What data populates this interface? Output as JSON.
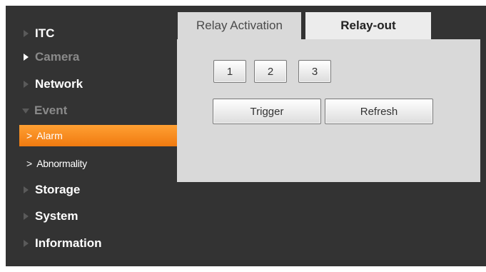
{
  "sidebar": {
    "items": [
      {
        "label": "ITC"
      },
      {
        "label": "Camera"
      },
      {
        "label": "Network"
      },
      {
        "label": "Event"
      },
      {
        "label": "Alarm"
      },
      {
        "label": "Abnormality"
      },
      {
        "label": "Storage"
      },
      {
        "label": "System"
      },
      {
        "label": "Information"
      }
    ]
  },
  "tabs": [
    {
      "label": "Relay Activation"
    },
    {
      "label": "Relay-out"
    }
  ],
  "relay_buttons": [
    {
      "label": "1"
    },
    {
      "label": "2"
    },
    {
      "label": "3"
    }
  ],
  "actions": {
    "trigger_label": "Trigger",
    "refresh_label": "Refresh"
  },
  "colors": {
    "sidebar_bg": "#333333",
    "active_item": "#f58a1f",
    "panel_bg": "#d9d9d9"
  }
}
